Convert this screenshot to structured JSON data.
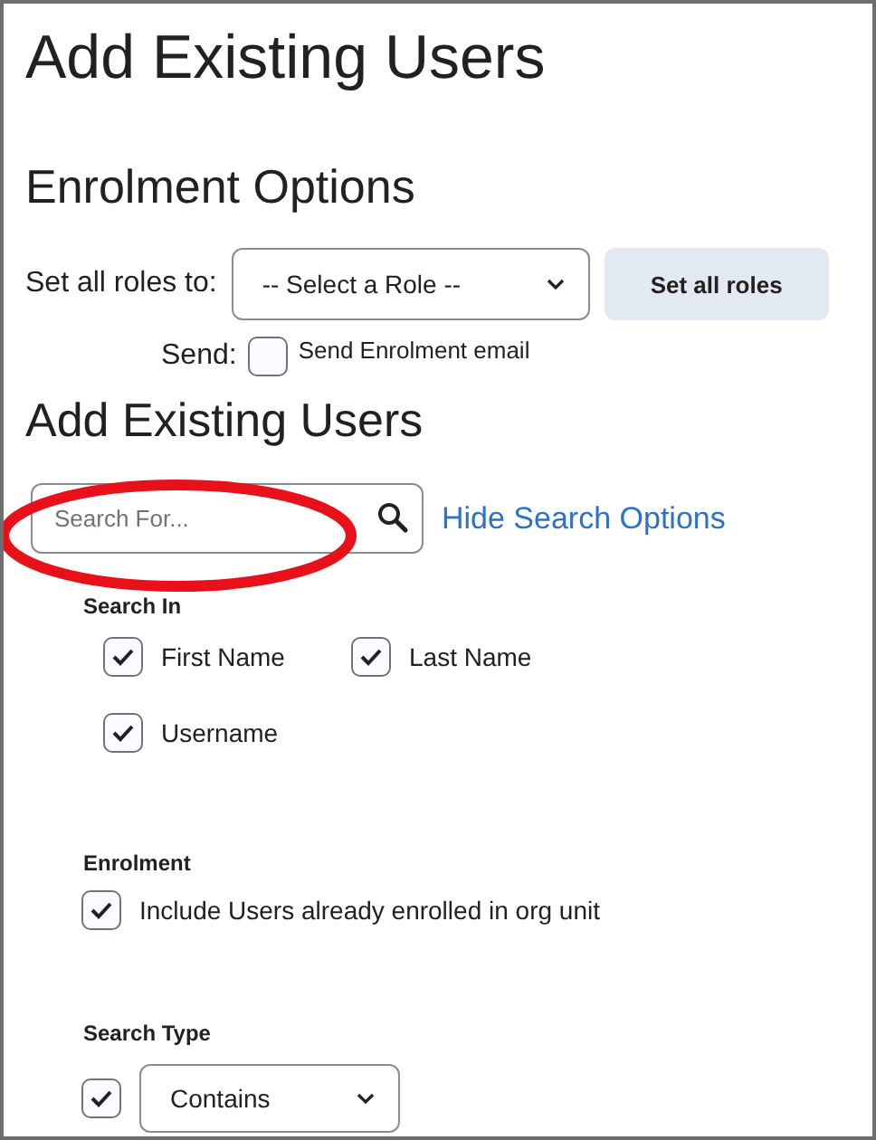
{
  "page_title": "Add Existing Users",
  "enrolment_options": {
    "heading": "Enrolment Options",
    "role_label": "Set all roles to:",
    "role_select": {
      "value": "-- Select a Role --"
    },
    "set_all_button": "Set all roles",
    "send_label": "Send:",
    "send_email": {
      "label": "Send Enrolment email",
      "checked": false
    }
  },
  "add_users": {
    "heading": "Add Existing Users",
    "search": {
      "placeholder": "Search For..."
    },
    "toggle_link": "Hide Search Options",
    "search_in": {
      "label": "Search In",
      "options": [
        {
          "label": "First Name",
          "checked": true
        },
        {
          "label": "Last Name",
          "checked": true
        },
        {
          "label": "Username",
          "checked": true
        }
      ]
    },
    "enrolment": {
      "label": "Enrolment",
      "option": {
        "label": "Include Users already enrolled in org unit",
        "checked": true
      }
    },
    "search_type": {
      "label": "Search Type",
      "checked": true,
      "value": "Contains"
    }
  }
}
